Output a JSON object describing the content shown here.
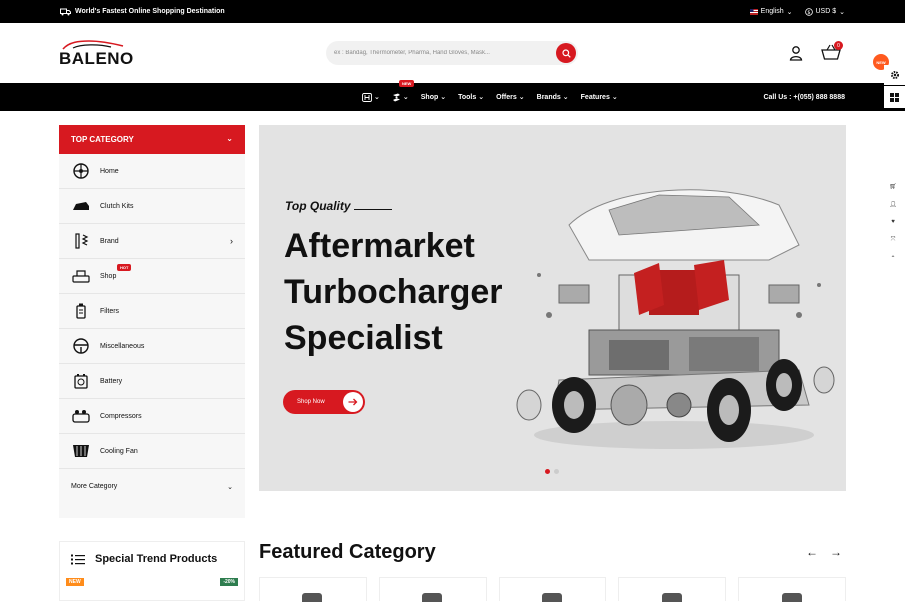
{
  "topbar": {
    "tagline": "World's Fastest Online Shopping Destination",
    "language": "English",
    "currency": "USD $"
  },
  "header": {
    "logo_text": "BALENO",
    "search_placeholder": "ex : Bandag, Thermometer, Pharma, Hand Gloves, Mask...",
    "cart_count": "0"
  },
  "nav": {
    "new_badge": "NEW",
    "items": [
      "Shop",
      "Tools",
      "Offers",
      "Brands",
      "Features"
    ],
    "call_label": "Call Us : +(055) 888 8888"
  },
  "side": {
    "new_badge": "NEW"
  },
  "categories": {
    "header": "TOP CATEGORY",
    "items": [
      {
        "label": "Home",
        "icon": "wheel-icon"
      },
      {
        "label": "Clutch Kits",
        "icon": "car-part-icon"
      },
      {
        "label": "Brand",
        "icon": "shock-absorber-icon"
      },
      {
        "label": "Shop",
        "icon": "car-seat-icon",
        "badge": "HOT"
      },
      {
        "label": "Filters",
        "icon": "filter-icon"
      },
      {
        "label": "Miscellaneous",
        "icon": "steering-wheel-icon"
      },
      {
        "label": "Battery",
        "icon": "battery-icon"
      },
      {
        "label": "Compressors",
        "icon": "compressor-icon"
      },
      {
        "label": "Cooling Fan",
        "icon": "fan-icon"
      }
    ],
    "more": "More Category"
  },
  "hero": {
    "eyebrow": "Top Quality",
    "title_lines": [
      "Aftermarket",
      "Turbocharger",
      "Specialist"
    ],
    "button": "Shop Now",
    "active_slide": 1,
    "slide_count": 2
  },
  "trend": {
    "title": "Special Trend Products",
    "badge_new": "NEW",
    "badge_discount": "-20%"
  },
  "featured": {
    "title": "Featured Category"
  },
  "colors": {
    "accent": "#d71920",
    "dark": "#000000"
  }
}
